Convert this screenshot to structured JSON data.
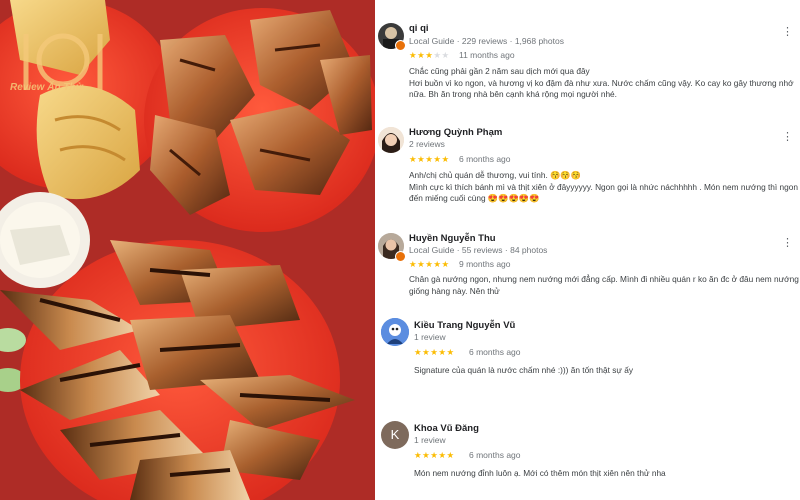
{
  "colors": {
    "star": "#fbbc04",
    "star_empty": "#dadce0",
    "text": "#3c4043",
    "meta": "#70757a"
  },
  "photo": {
    "watermark": "Review Ăn Thử",
    "watermark_icon": "plate-fork-knife-logo"
  },
  "reviews": [
    {
      "name": "qi qi",
      "meta": "Local Guide · 229 reviews · 1,968 photos",
      "rating": 3,
      "time": "11 months ago",
      "text": "Chắc cũng phải gần 2 năm sau dịch mới qua đây\nHơi buồn vì ko ngon, và hương vị ko đậm đà như xưa. Nước chấm cũng vậy. Ko cay ko gây thương nhớ nữa. Bh ăn trong nhà bên cạnh khá rộng mọi người nhé."
    },
    {
      "name": "Hương Quỳnh Phạm",
      "meta": "2 reviews",
      "rating": 5,
      "time": "6 months ago",
      "text": "Anh/chị chủ quán dễ thương, vui tính. 😚😚😚\nMình cực kì thích bánh mì và thịt xiên ở đâyyyyyy. Ngon gọi là nhức náchhhhh . Món nem nướng thì ngon đến miếng cuối cùng 😍😍😍😍😍"
    },
    {
      "name": "Huyền Nguyễn Thu",
      "meta": "Local Guide · 55 reviews · 84 photos",
      "rating": 5,
      "time": "9 months ago",
      "text": "Chân gà nướng ngon, nhưng nem nướng mới đẳng cấp. Mình đi nhiều quán r ko ăn đc ở đâu nem nướng giống hàng này. Nên thử"
    },
    {
      "name": "Kiều Trang Nguyễn Vũ",
      "meta": "1 review",
      "rating": 5,
      "time": "6 months ago",
      "text": "Signature của quán là nước chấm nhé :))) ăn tốn thật sự ấy"
    },
    {
      "name": "Khoa Vũ Đăng",
      "meta": "1 review",
      "rating": 5,
      "time": "6 months ago",
      "text": "Món nem nướng đỉnh luôn ạ. Mới có thêm món thịt xiên nên thử nha",
      "avatar_letter": "K"
    }
  ]
}
